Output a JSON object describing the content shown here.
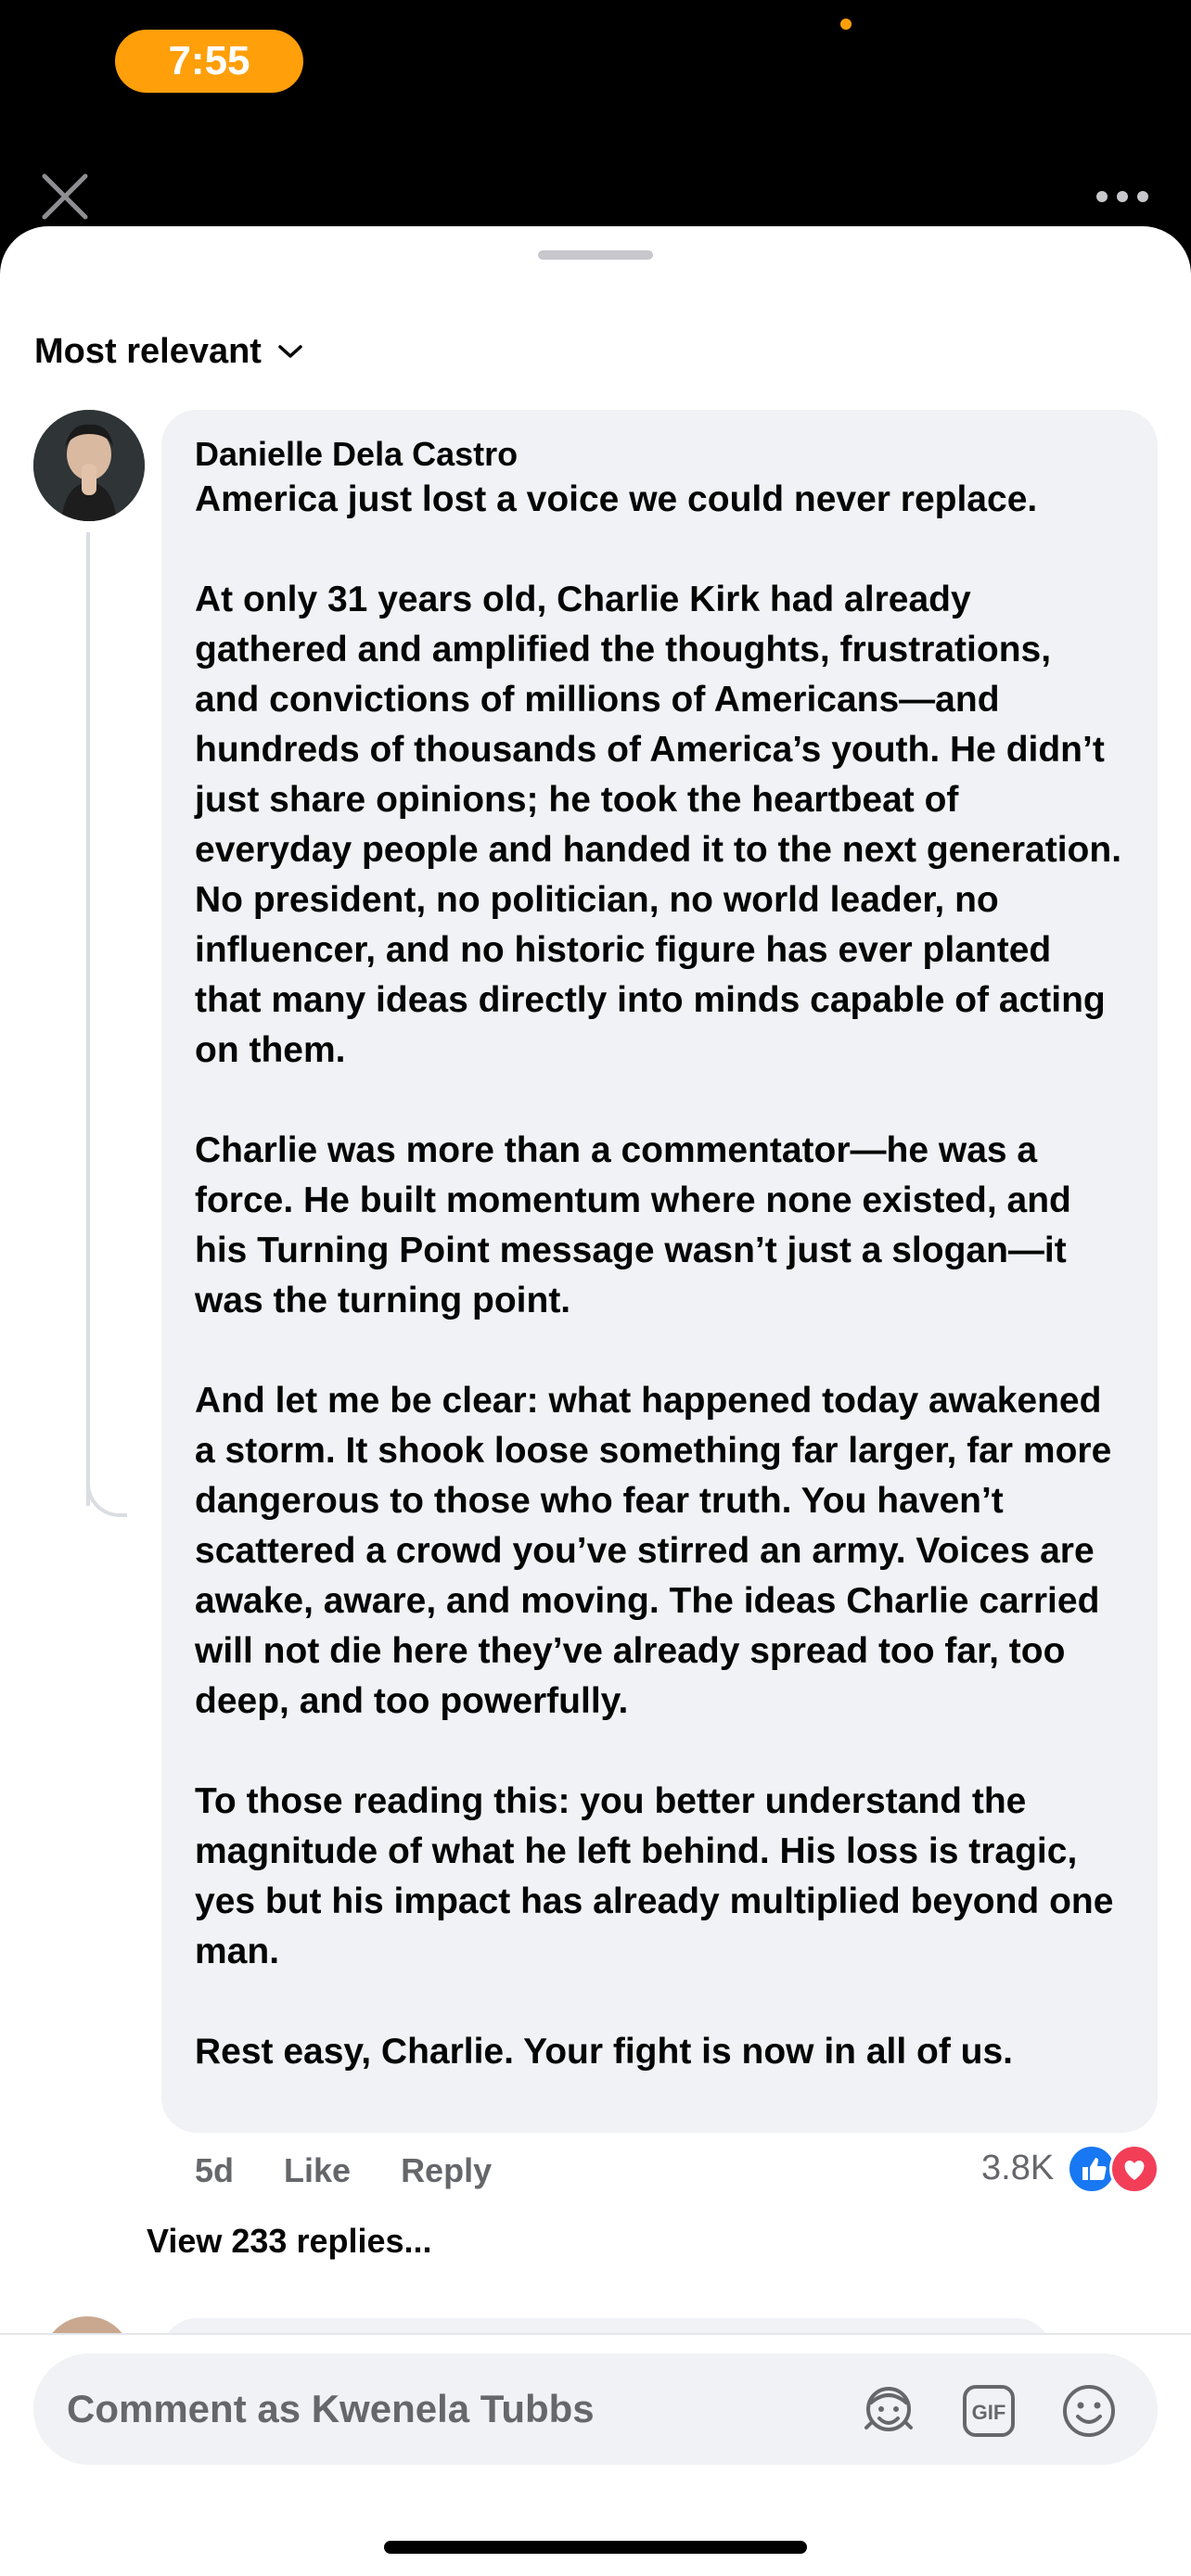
{
  "status_bar": {
    "time": "7:55"
  },
  "sheet": {
    "sort": {
      "label": "Most relevant"
    },
    "comment": {
      "author": "Danielle Dela Castro",
      "text": "America just lost a voice we could never replace.\n\nAt only 31 years old, Charlie Kirk had already gathered and amplified the thoughts, frustrations, and convictions of millions of Americans—and hundreds of thousands of America’s youth. He didn’t just share opinions; he took the heartbeat of everyday people and handed it to the next generation. No president, no politician, no world leader, no influencer, and no historic figure has ever planted that many ideas directly into minds capable of acting on them.\n\nCharlie was more than a commentator—he was a force. He built momentum where none existed, and his Turning Point message wasn’t just a slogan—it was the turning point.\n\nAnd let me be clear: what happened today awakened a storm. It shook loose something far larger, far more dangerous to those who fear truth. You haven’t scattered a crowd you’ve stirred an army. Voices are awake, aware, and moving. The ideas Charlie carried will not die here they’ve already spread too far, too deep, and too powerfully.\n\nTo those reading this: you better understand the magnitude of what he left behind. His loss is tragic, yes but his impact has already multiplied beyond one man.\n\nRest easy, Charlie. Your fight is now in all of us.",
      "time": "5d",
      "like_label": "Like",
      "reply_label": "Reply",
      "reaction_count": "3.8K",
      "reactions": [
        "like",
        "love"
      ],
      "view_replies": "View 233 replies..."
    }
  },
  "composer": {
    "placeholder": "Comment as Kwenela Tubbs",
    "icons": [
      "avatar-sticker-icon",
      "gif-icon",
      "emoji-icon"
    ]
  },
  "colors": {
    "accent_orange": "#FF9F0A",
    "bubble_bg": "#F0F2F5",
    "secondary_text": "#65676B",
    "like_blue": "#1877F2",
    "love_red": "#F33E58"
  }
}
